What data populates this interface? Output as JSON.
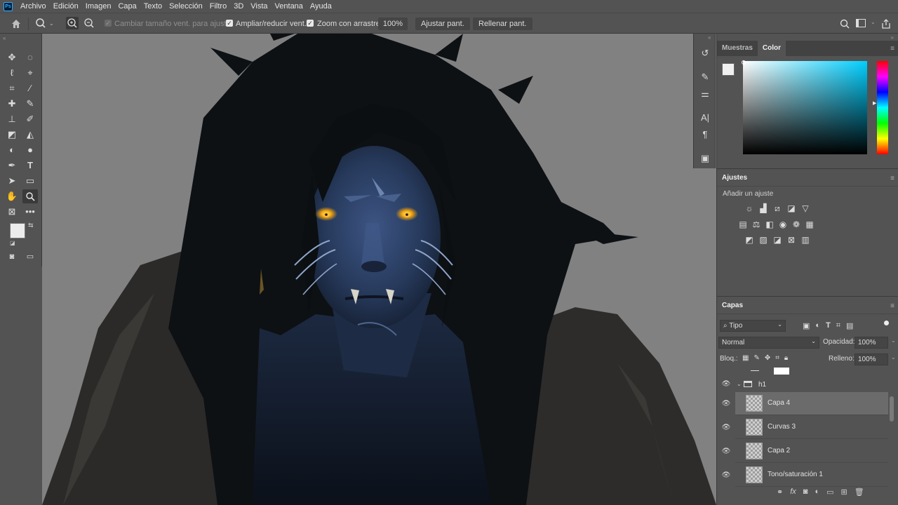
{
  "app": {
    "logo_text": "Ps"
  },
  "menu": [
    "Archivo",
    "Edición",
    "Imagen",
    "Capa",
    "Texto",
    "Selección",
    "Filtro",
    "3D",
    "Vista",
    "Ventana",
    "Ayuda"
  ],
  "options_bar": {
    "resize_windows_label": "Cambiar tamaño vent. para ajustar",
    "zoom_all_label": "Ampliar/reducir vent.",
    "scrubby_zoom_label": "Zoom con arrastre",
    "zoom_value": "100%",
    "fit_screen_label": "Ajustar pant.",
    "fill_screen_label": "Rellenar pant."
  },
  "color_panel": {
    "tabs": [
      "Muestras",
      "Color"
    ],
    "active_tab": "Color",
    "hue_color": "#00cfff"
  },
  "adjustments_panel": {
    "title": "Ajustes",
    "subtitle": "Añadir un ajuste"
  },
  "layers_panel": {
    "title": "Capas",
    "filter_kind": "Tipo",
    "blend_mode": "Normal",
    "opacity_label": "Opacidad:",
    "opacity_value": "100%",
    "lock_label": "Bloq.:",
    "fill_label": "Relleno:",
    "fill_value": "100%",
    "group_name": "h1",
    "layers": [
      {
        "name": "Capa 4",
        "selected": true
      },
      {
        "name": "Curvas 3",
        "selected": false
      },
      {
        "name": "Capa 2",
        "selected": false
      },
      {
        "name": "Tono/saturación 1",
        "selected": false
      }
    ]
  },
  "colors": {
    "accent": "#31a8ff",
    "panel_bg": "#535353",
    "canvas_bg": "#818181",
    "skin": "#2c3f5e",
    "eyes": "#f2a20a"
  }
}
